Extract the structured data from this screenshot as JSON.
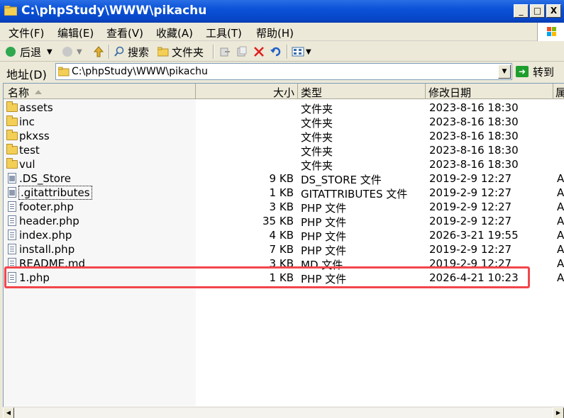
{
  "window": {
    "title": "C:\\phpStudy\\WWW\\pikachu",
    "min": "_",
    "max": "□",
    "close": "X"
  },
  "menu": [
    "文件(F)",
    "编辑(E)",
    "查看(V)",
    "收藏(A)",
    "工具(T)",
    "帮助(H)"
  ],
  "toolbar": {
    "back": "后退",
    "search": "搜索",
    "folders": "文件夹"
  },
  "address": {
    "label": "地址(D)",
    "value": "C:\\phpStudy\\WWW\\pikachu",
    "go": "转到"
  },
  "columns": {
    "name": "名称",
    "size": "大小",
    "type": "类型",
    "modified": "修改日期",
    "attr": "属"
  },
  "files": [
    {
      "name": "assets",
      "size": "",
      "type": "文件夹",
      "modified": "2023-8-16 18:30",
      "attr": "",
      "icon": "folder-icon"
    },
    {
      "name": "inc",
      "size": "",
      "type": "文件夹",
      "modified": "2023-8-16 18:30",
      "attr": "",
      "icon": "folder-icon"
    },
    {
      "name": "pkxss",
      "size": "",
      "type": "文件夹",
      "modified": "2023-8-16 18:30",
      "attr": "",
      "icon": "folder-icon"
    },
    {
      "name": "test",
      "size": "",
      "type": "文件夹",
      "modified": "2023-8-16 18:30",
      "attr": "",
      "icon": "folder-icon"
    },
    {
      "name": "vul",
      "size": "",
      "type": "文件夹",
      "modified": "2023-8-16 18:30",
      "attr": "",
      "icon": "folder-icon"
    },
    {
      "name": ".DS_Store",
      "size": "9 KB",
      "type": "DS_STORE 文件",
      "modified": "2019-2-9 12:27",
      "attr": "A",
      "icon": "system-file-icon"
    },
    {
      "name": ".gitattributes",
      "size": "1 KB",
      "type": "GITATTRIBUTES 文件",
      "modified": "2019-2-9 12:27",
      "attr": "A",
      "icon": "system-file-icon"
    },
    {
      "name": "footer.php",
      "size": "3 KB",
      "type": "PHP 文件",
      "modified": "2019-2-9 12:27",
      "attr": "A",
      "icon": "php-file-icon"
    },
    {
      "name": "header.php",
      "size": "35 KB",
      "type": "PHP 文件",
      "modified": "2019-2-9 12:27",
      "attr": "A",
      "icon": "php-file-icon"
    },
    {
      "name": "index.php",
      "size": "4 KB",
      "type": "PHP 文件",
      "modified": "2026-3-21 19:55",
      "attr": "A",
      "icon": "php-file-icon"
    },
    {
      "name": "install.php",
      "size": "7 KB",
      "type": "PHP 文件",
      "modified": "2019-2-9 12:27",
      "attr": "A",
      "icon": "php-file-icon"
    },
    {
      "name": "README.md",
      "size": "3 KB",
      "type": "MD 文件",
      "modified": "2019-2-9 12:27",
      "attr": "A",
      "icon": "md-file-icon"
    },
    {
      "name": "1.php",
      "size": "1 KB",
      "type": "PHP 文件",
      "modified": "2026-4-21 10:23",
      "attr": "A",
      "icon": "php-file-icon"
    }
  ],
  "colors": {
    "title_bar": "#0a52d8",
    "highlight_border": "#f2464b",
    "window_bg": "#ece9d8"
  }
}
